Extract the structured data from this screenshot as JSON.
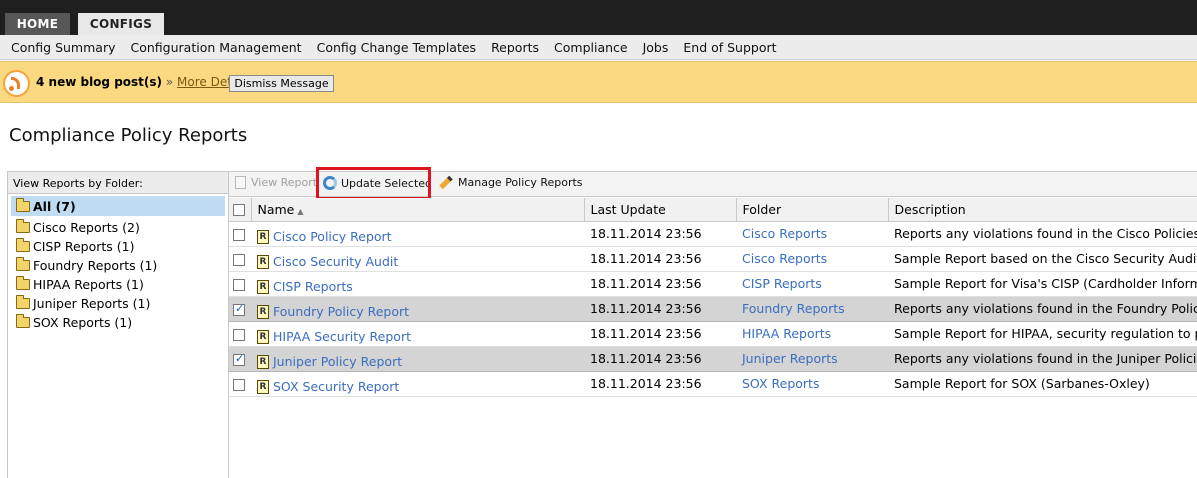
{
  "top_tabs": [
    {
      "label": "HOME"
    },
    {
      "label": "CONFIGS"
    }
  ],
  "menu": [
    {
      "label": "Config Summary"
    },
    {
      "label": "Configuration Management"
    },
    {
      "label": "Config Change Templates"
    },
    {
      "label": "Reports"
    },
    {
      "label": "Compliance"
    },
    {
      "label": "Jobs"
    },
    {
      "label": "End of Support"
    }
  ],
  "banner": {
    "message": "4 new blog post(s)",
    "separator": "»",
    "link": "More Details",
    "dismiss": "Dismiss Message",
    "background": "#fbd981"
  },
  "page_title": "Compliance Policy Reports",
  "left_panel": {
    "header": "View Reports by Folder:",
    "folders": [
      {
        "label": "All (7)",
        "selected": true
      },
      {
        "label": "Cisco Reports (2)"
      },
      {
        "label": "CISP Reports (1)"
      },
      {
        "label": "Foundry Reports (1)"
      },
      {
        "label": "HIPAA Reports (1)"
      },
      {
        "label": "Juniper Reports (1)"
      },
      {
        "label": "SOX Reports (1)"
      }
    ]
  },
  "toolbar": {
    "view_report": "View Report",
    "update_selected": "Update Selected",
    "manage_policy_reports": "Manage Policy Reports"
  },
  "table": {
    "columns": [
      "Name",
      "Last Update",
      "Folder",
      "Description"
    ],
    "rows": [
      {
        "name": "Cisco Policy Report",
        "last_update": "18.11.2014 23:56",
        "folder": "Cisco Reports",
        "description": "Reports any violations found in the Cisco Policies",
        "checked": false
      },
      {
        "name": "Cisco Security Audit",
        "last_update": "18.11.2014 23:56",
        "folder": "Cisco Reports",
        "description": "Sample Report based on the Cisco Security Auditor",
        "checked": false
      },
      {
        "name": "CISP Reports",
        "last_update": "18.11.2014 23:56",
        "folder": "CISP Reports",
        "description": "Sample Report for Visa's CISP (Cardholder Informati",
        "checked": false
      },
      {
        "name": "Foundry Policy Report",
        "last_update": "18.11.2014 23:56",
        "folder": "Foundry Reports",
        "description": "Reports any violations found in the Foundry Policies",
        "checked": true
      },
      {
        "name": "HIPAA Security Report",
        "last_update": "18.11.2014 23:56",
        "folder": "HIPAA Reports",
        "description": "Sample Report for HIPAA, security regulation to prot",
        "checked": false
      },
      {
        "name": "Juniper Policy Report",
        "last_update": "18.11.2014 23:56",
        "folder": "Juniper Reports",
        "description": "Reports any violations found in the Juniper Policies",
        "checked": true
      },
      {
        "name": "SOX Security Report",
        "last_update": "18.11.2014 23:56",
        "folder": "SOX Reports",
        "description": "Sample Report for SOX (Sarbanes-Oxley)",
        "checked": false
      }
    ]
  },
  "colors": {
    "link": "#3a6ec0",
    "highlight": "#e0141e",
    "selected_folder": "#bfdcf3"
  }
}
